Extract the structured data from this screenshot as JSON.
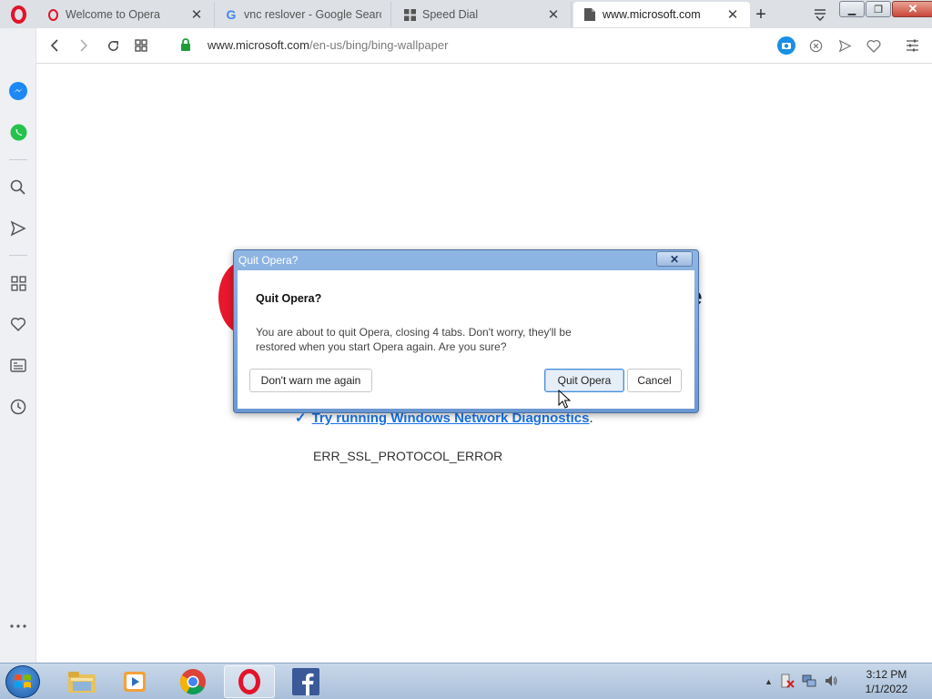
{
  "browser": {
    "tabs": [
      {
        "title": "Welcome to Opera",
        "favicon": "opera-icon",
        "active": false
      },
      {
        "title": "vnc reslover - Google Search",
        "favicon": "google-icon",
        "active": false
      },
      {
        "title": "Speed Dial",
        "favicon": "speed-dial-icon",
        "active": false
      },
      {
        "title": "www.microsoft.com",
        "favicon": "page-icon",
        "active": true
      }
    ],
    "address": {
      "host": "www.microsoft.com",
      "path": "/en-us/bing/bing-wallpaper"
    },
    "accent_color": "#e2132a"
  },
  "page": {
    "heading_fragment": "ure",
    "diagnostics_link": "Try running Windows Network Diagnostics",
    "diagnostics_suffix": ".",
    "error_code": "ERR_SSL_PROTOCOL_ERROR"
  },
  "dialog": {
    "window_title": "Quit Opera?",
    "heading": "Quit Opera?",
    "message": "You are about to quit Opera, closing 4 tabs. Don't worry, they'll be restored when you start Opera again. Are you sure?",
    "dont_warn_label": "Don't warn me again",
    "quit_label": "Quit Opera",
    "cancel_label": "Cancel"
  },
  "taskbar": {
    "time": "3:12 PM",
    "date": "1/1/2022"
  }
}
